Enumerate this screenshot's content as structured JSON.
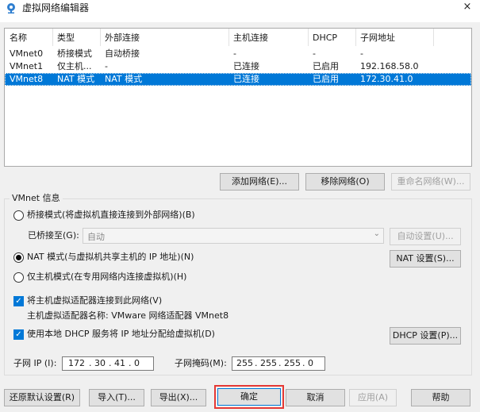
{
  "window": {
    "title": "虚拟网络编辑器",
    "close": "×"
  },
  "table": {
    "columns": [
      "名称",
      "类型",
      "外部连接",
      "主机连接",
      "DHCP",
      "子网地址"
    ],
    "rows": [
      [
        "VMnet0",
        "桥接模式",
        "自动桥接",
        "-",
        "-",
        "-"
      ],
      [
        "VMnet1",
        "仅主机...",
        "-",
        "已连接",
        "已启用",
        "192.168.58.0"
      ],
      [
        "VMnet8",
        "NAT 模式",
        "NAT 模式",
        "已连接",
        "已启用",
        "172.30.41.0"
      ]
    ],
    "selected_row": 2
  },
  "table_buttons": {
    "add": "添加网络(E)...",
    "remove": "移除网络(O)",
    "rename": "重命名网络(W)..."
  },
  "vmnet_info": {
    "title": "VMnet 信息",
    "bridged_label": "桥接模式(将虚拟机直接连接到外部网络)(B)",
    "bridged_to_label": "已桥接至(G):",
    "bridged_to_value": "自动",
    "auto_settings": "自动设置(U)...",
    "nat_label": "NAT 模式(与虚拟机共享主机的 IP 地址)(N)",
    "nat_settings": "NAT 设置(S)...",
    "hostonly_label": "仅主机模式(在专用网络内连接虚拟机)(H)",
    "connect_adapter_label": "将主机虚拟适配器连接到此网络(V)",
    "adapter_name_label": "主机虚拟适配器名称: VMware 网络适配器 VMnet8",
    "dhcp_label": "使用本地 DHCP 服务将 IP 地址分配给虚拟机(D)",
    "dhcp_settings": "DHCP 设置(P)...",
    "subnet_ip_label": "子网 IP (I):",
    "subnet_ip": [
      "172",
      "30",
      "41",
      "0"
    ],
    "subnet_mask_label": "子网掩码(M):",
    "subnet_mask": [
      "255",
      "255",
      "255",
      "0"
    ]
  },
  "bottom_buttons": {
    "restore": "还原默认设置(R)",
    "import": "导入(T)...",
    "export": "导出(X)...",
    "ok": "确定",
    "cancel": "取消",
    "apply": "应用(A)",
    "help": "帮助"
  },
  "state": {
    "mode": "nat",
    "connect_adapter": true,
    "dhcp": true
  },
  "colors": {
    "selection": "#0078d7",
    "highlight_box": "#e53935"
  }
}
